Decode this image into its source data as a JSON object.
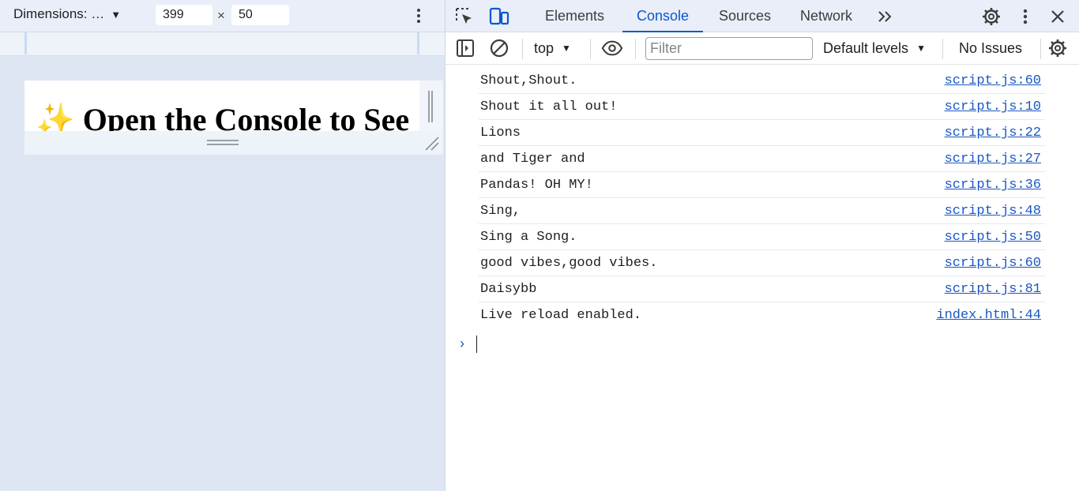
{
  "device_toolbar": {
    "dimensions_label": "Dimensions: …",
    "width_value": "399",
    "times_glyph": "×",
    "height_value": "50",
    "more_icon": "kebab-vertical-icon"
  },
  "viewport": {
    "heading": "✨ Open the Console to See"
  },
  "devtools": {
    "tabs": [
      {
        "label": "Elements"
      },
      {
        "label": "Console"
      },
      {
        "label": "Sources"
      },
      {
        "label": "Network"
      }
    ],
    "active_tab": "Console",
    "more_tabs_glyph": "»",
    "icons": [
      "inspect-element-icon",
      "device-toolbar-icon",
      "settings-gear-icon",
      "kebab-vertical-icon",
      "close-icon"
    ]
  },
  "console_toolbar": {
    "context": "top",
    "filter_placeholder": "Filter",
    "levels": "Default levels",
    "issues": "No Issues",
    "icons": [
      "sidebar-toggle-icon",
      "clear-console-icon",
      "eye-icon",
      "settings-gear-icon"
    ]
  },
  "console_log": [
    {
      "message": "Shout,Shout.",
      "source": "script.js:60"
    },
    {
      "message": "Shout it all out!",
      "source": "script.js:10"
    },
    {
      "message": "Lions",
      "source": "script.js:22"
    },
    {
      "message": "and Tiger and",
      "source": "script.js:27"
    },
    {
      "message": "Pandas! OH MY!",
      "source": "script.js:36"
    },
    {
      "message": "Sing,",
      "source": "script.js:48"
    },
    {
      "message": "Sing a Song.",
      "source": "script.js:50"
    },
    {
      "message": "good vibes,good vibes.",
      "source": "script.js:60"
    },
    {
      "message": "Daisybb",
      "source": "script.js:81"
    },
    {
      "message": "Live reload enabled.",
      "source": "index.html:44"
    }
  ],
  "prompt": {
    "glyph": "›"
  },
  "colors": {
    "accent": "#0b57d0",
    "link": "#1a57c2",
    "toolbar_bg": "#e9eef8",
    "pane_bg": "#dfe6f3"
  }
}
